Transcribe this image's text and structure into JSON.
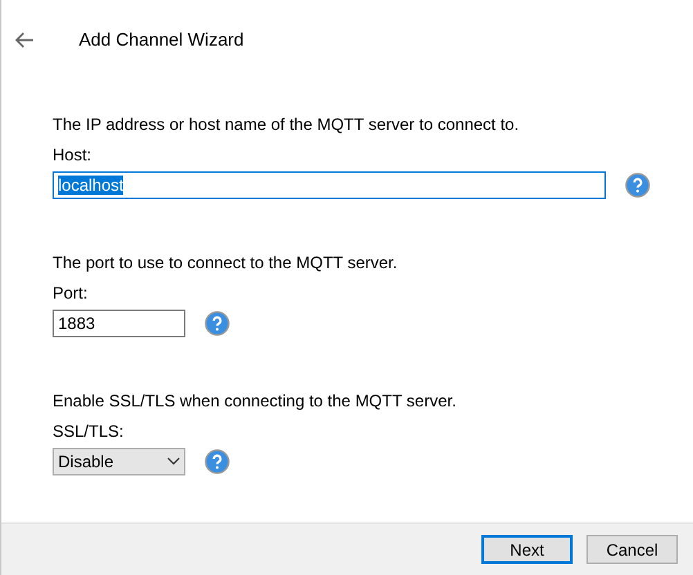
{
  "header": {
    "title": "Add Channel Wizard"
  },
  "fields": [
    {
      "kind": "text",
      "description": "The IP address or host name of the MQTT server to connect to.",
      "label": "Host:",
      "value": "localhost",
      "focused": true,
      "wide": true
    },
    {
      "kind": "text",
      "description": "The port to use to connect to the MQTT server.",
      "label": "Port:",
      "value": "1883",
      "focused": false,
      "wide": false
    },
    {
      "kind": "select",
      "description": "Enable SSL/TLS when connecting to the MQTT server.",
      "label": "SSL/TLS:",
      "value": "Disable",
      "focused": false,
      "wide": false
    }
  ],
  "buttons": [
    {
      "label": "Next",
      "default": true
    },
    {
      "label": "Cancel",
      "default": false
    }
  ]
}
